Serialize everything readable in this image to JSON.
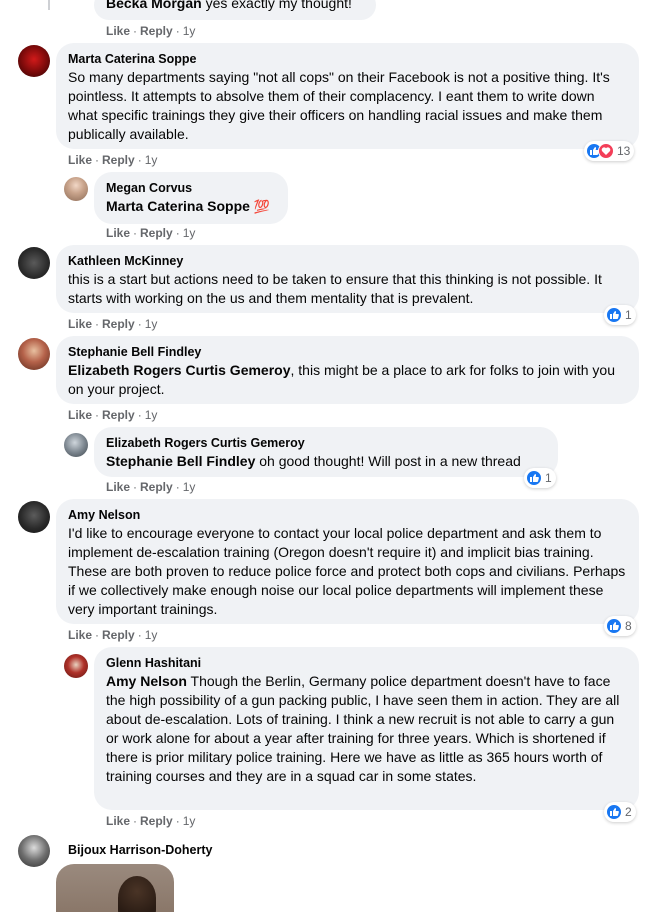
{
  "colors": {
    "bubble_bg": "#f0f2f5",
    "meta_text": "#65676b",
    "like_blue": "#1877f2",
    "love_red": "#f33e58"
  },
  "actions": {
    "like": "Like",
    "reply": "Reply",
    "separator": "·"
  },
  "comments": [
    {
      "author": "Becka Morgan",
      "text": "yes exactly my thought!",
      "time": "1y"
    },
    {
      "author": "Marta Caterina Soppe",
      "text": "So many departments saying \"not all cops\" on their Facebook is not a positive thing. It's pointless. It attempts to absolve them of their complacency. I eant them to write down what specific trainings they give their officers on handling racial issues and make them publically available.",
      "time": "1y",
      "reactions": {
        "icons": [
          "like-icon",
          "love-icon"
        ],
        "count": "13"
      }
    },
    {
      "author": "Megan Corvus",
      "mention": "Marta Caterina Soppe",
      "emoji": "💯",
      "time": "1y"
    },
    {
      "author": "Kathleen McKinney",
      "text": "this is a start but actions need to be taken to ensure that this thinking is not possible. It starts with working on the us and them mentality that is prevalent.",
      "time": "1y",
      "reactions": {
        "icons": [
          "like-icon"
        ],
        "count": "1"
      }
    },
    {
      "author": "Stephanie Bell Findley",
      "mention": "Elizabeth Rogers Curtis Gemeroy",
      "text": ", this might be a place to ark for folks to join with you on your project.",
      "time": "1y"
    },
    {
      "author": "Elizabeth Rogers Curtis Gemeroy",
      "mention": "Stephanie Bell Findley",
      "text": " oh good thought! Will post in a new thread",
      "time": "1y",
      "reactions": {
        "icons": [
          "like-icon"
        ],
        "count": "1"
      }
    },
    {
      "author": "Amy Nelson",
      "text": "I'd like to encourage everyone to contact your local police department and ask them to implement de-escalation training (Oregon doesn't require it) and implicit bias training. These are both proven to reduce police force and protect both cops and civilians. Perhaps if we collectively make enough noise our local police departments will implement these very important trainings.",
      "time": "1y",
      "reactions": {
        "icons": [
          "like-icon"
        ],
        "count": "8"
      }
    },
    {
      "author": "Glenn Hashitani",
      "mention": "Amy Nelson",
      "text": " Though the Berlin, Germany police department doesn't have to face the high possibility of a gun packing public, I have seen them in action. They are all about de-escalation. Lots of training. I think a new recruit is not able to carry a gun or work alone for about a year after training for three years. Which is shortened if there is prior military police training. Here we have as little as 365 hours worth of training courses and they are in a squad car in some states.",
      "time": "1y",
      "reactions": {
        "icons": [
          "like-icon"
        ],
        "count": "2"
      }
    },
    {
      "author": "Bijoux Harrison-Doherty"
    }
  ]
}
